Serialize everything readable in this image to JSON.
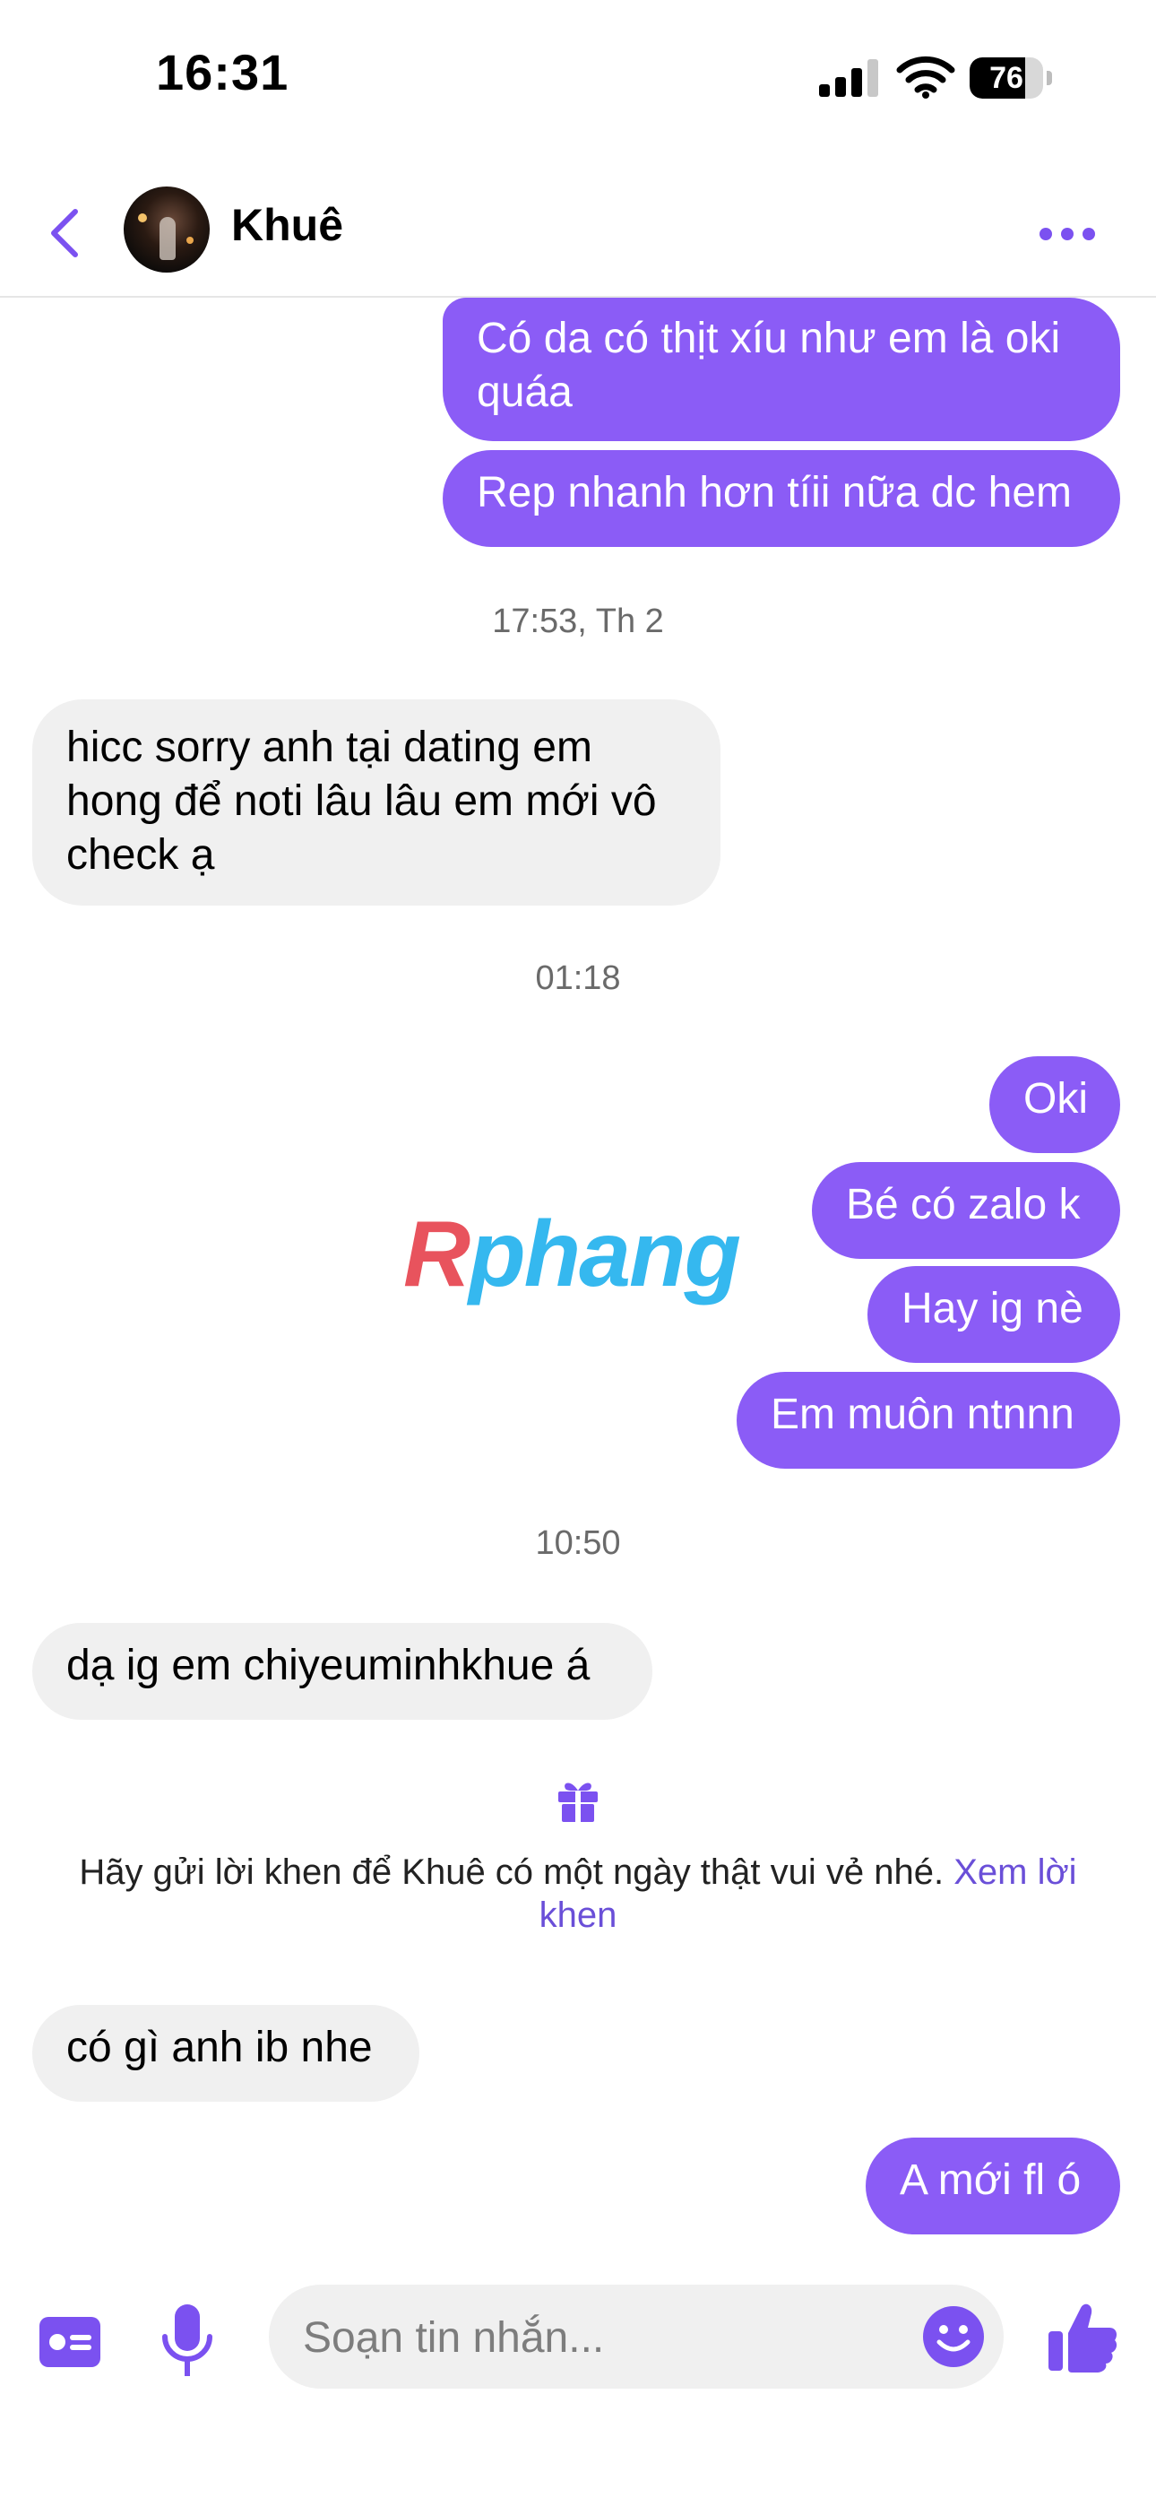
{
  "status_bar": {
    "time": "16:31",
    "battery": "76",
    "battery_level": 0.76
  },
  "header": {
    "contact_name": "Khuê"
  },
  "messages": [
    {
      "lines": [
        "Có da có thịt xíu như em là oki",
        "quáa"
      ]
    },
    {
      "text": "Rep nhanh hơn tíii nữa dc hem"
    },
    {
      "text": "hicc sorry anh tại dating em hong để noti lâu lâu em mới vô check ạ"
    },
    {
      "text": "Oki"
    },
    {
      "text": "Bé có zalo k"
    },
    {
      "text": "Hay ig nè"
    },
    {
      "text": "Em muôn ntnnn"
    },
    {
      "text": "dạ ig em chiyeuminhkhue á"
    },
    {
      "text": "có gì anh ib nhe"
    },
    {
      "text": "A mới fl ó"
    }
  ],
  "timestamps": [
    "17:53, Th 2",
    "01:18",
    "10:50"
  ],
  "watermark": {
    "r": "R",
    "rest": "phang"
  },
  "compliment": {
    "text": "Hãy gửi lời khen để Khuê có một ngày thật vui vẻ nhé. ",
    "link": "Xem lời khen"
  },
  "composer": {
    "placeholder": "Soạn tin nhắn..."
  },
  "colors": {
    "accent": "#8b5cf6",
    "link": "#6a4fd8",
    "bubble_received": "#f0f0f0"
  }
}
